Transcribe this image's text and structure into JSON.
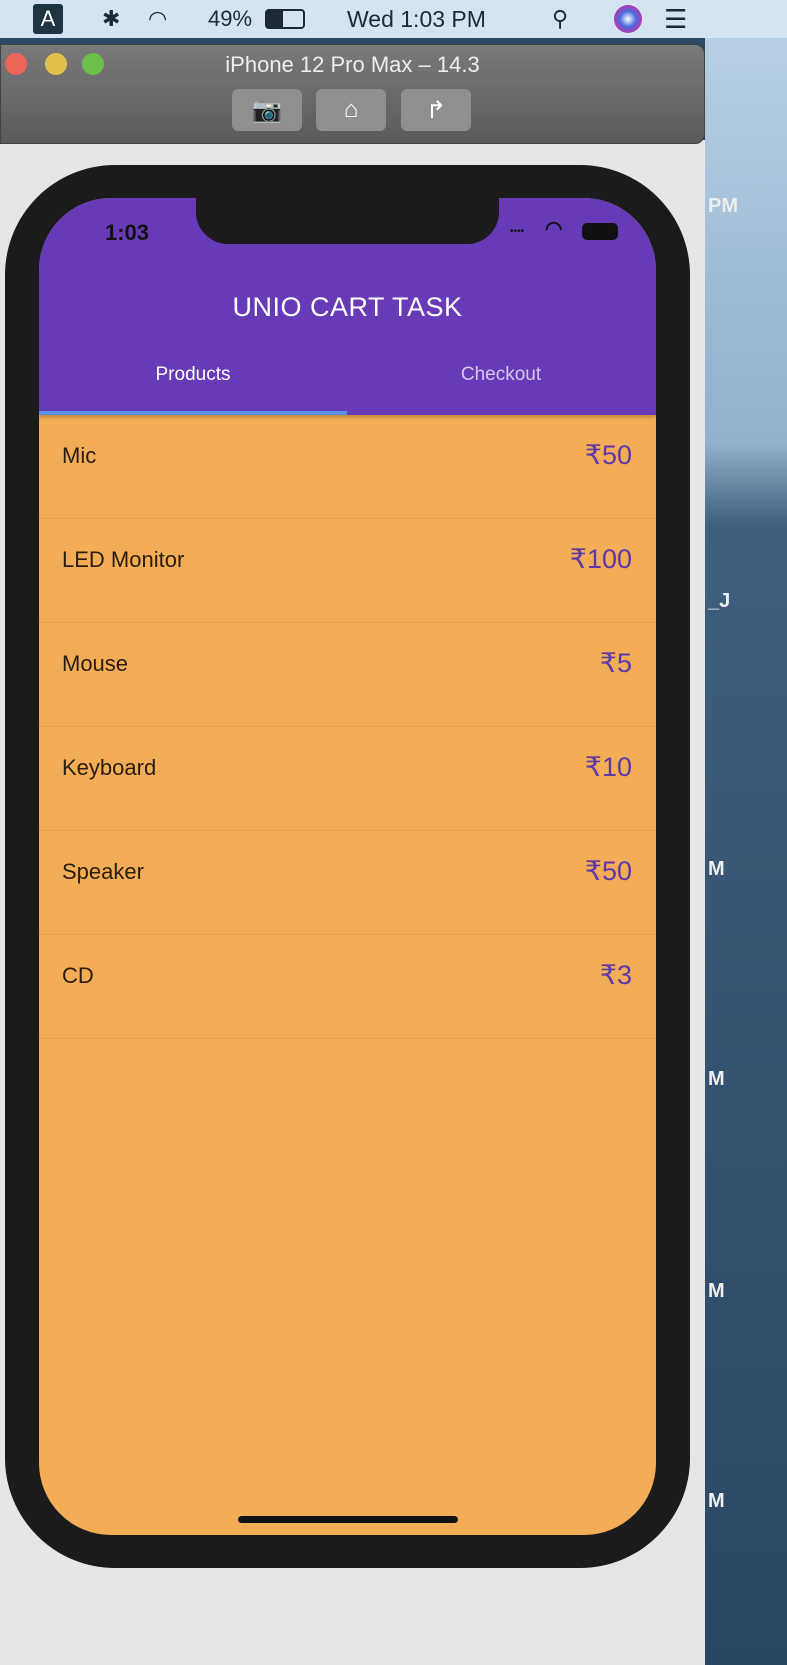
{
  "menubar": {
    "input_source": "A",
    "battery": "49%",
    "clock": "Wed 1:03 PM",
    "icons": [
      "bluetooth-icon",
      "wifi-icon",
      "battery-icon",
      "search-icon",
      "siri-icon",
      "list-icon"
    ]
  },
  "simulator": {
    "title": "iPhone 12 Pro Max – 14.3",
    "buttons": [
      "screenshot-icon",
      "home-icon",
      "rotate-icon"
    ]
  },
  "phone": {
    "time": "1:03"
  },
  "app": {
    "title": "UNIO CART TASK",
    "tabs": [
      {
        "label": "Products",
        "active": true
      },
      {
        "label": "Checkout",
        "active": false
      }
    ],
    "products": [
      {
        "name": "Mic",
        "price": "₹50"
      },
      {
        "name": "LED Monitor",
        "price": "₹100"
      },
      {
        "name": "Mouse",
        "price": "₹5"
      },
      {
        "name": "Keyboard",
        "price": "₹10"
      },
      {
        "name": "Speaker",
        "price": "₹50"
      },
      {
        "name": "CD",
        "price": "₹3"
      }
    ]
  },
  "colors": {
    "appbar": "#673ab7",
    "background": "#f2ad56",
    "price": "#5d39a8",
    "indicator": "#5b8fe0"
  }
}
